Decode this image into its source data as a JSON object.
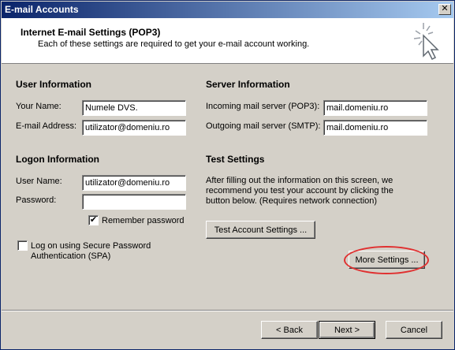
{
  "window": {
    "title": "E-mail Accounts",
    "close_glyph": "✕"
  },
  "header": {
    "title": "Internet E-mail Settings (POP3)",
    "subtitle": "Each of these settings are required to get your e-mail account working.",
    "icon": "wizard-wand-icon"
  },
  "user_info": {
    "title": "User Information",
    "name_label": "Your Name:",
    "name_value": "Numele DVS.",
    "email_label": "E-mail Address:",
    "email_value": "utilizator@domeniu.ro"
  },
  "logon_info": {
    "title": "Logon Information",
    "username_label": "User Name:",
    "username_value": "utilizator@domeniu.ro",
    "password_label": "Password:",
    "password_value": "",
    "remember_label": "Remember password",
    "remember_checked": true,
    "remember_glyph": "✔",
    "spa_label_line1": "Log on using Secure Password",
    "spa_label_line2": "Authentication (SPA)",
    "spa_checked": false
  },
  "server_info": {
    "title": "Server Information",
    "incoming_label": "Incoming mail server (POP3):",
    "incoming_value": "mail.domeniu.ro",
    "outgoing_label": "Outgoing mail server (SMTP):",
    "outgoing_value": "mail.domeniu.ro"
  },
  "test_settings": {
    "title": "Test Settings",
    "desc_line1": "After filling out the information on this screen, we",
    "desc_line2": "recommend you test your account by clicking the",
    "desc_line3": "button below. (Requires network connection)",
    "test_button": "Test Account Settings ...",
    "more_button": "More Settings ..."
  },
  "footer": {
    "back_label": "< Back",
    "next_label": "Next >",
    "cancel_label": "Cancel"
  },
  "colors": {
    "highlight_ring": "#e03030",
    "title_bar": "#0a246a"
  }
}
